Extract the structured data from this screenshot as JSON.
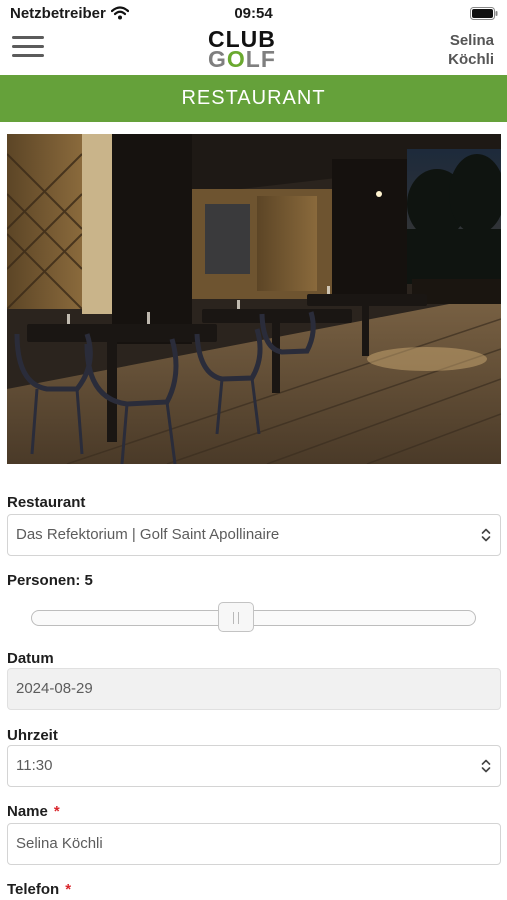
{
  "status_bar": {
    "carrier": "Netzbetreiber",
    "time": "09:54"
  },
  "header": {
    "logo_line1": "CLUB",
    "logo_line2_a": "G",
    "logo_line2_o": "O",
    "logo_line2_b": "LF",
    "user_first": "Selina",
    "user_last": "Köchli"
  },
  "page_title": "RESTAURANT",
  "form": {
    "restaurant_label": "Restaurant",
    "restaurant_value": "Das Refektorium | Golf Saint Apollinaire",
    "persons_label": "Personen: 5",
    "persons_value": 5,
    "persons_fraction": 0.46,
    "date_label": "Datum",
    "date_value": "2024-08-29",
    "time_label": "Uhrzeit",
    "time_value": "11:30",
    "name_label": "Name",
    "name_value": "Selina Köchli",
    "phone_label": "Telefon",
    "required_mark": "*"
  },
  "colors": {
    "accent": "#65a13a",
    "required": "#d9262c",
    "logo_green": "#6aa92f"
  },
  "icons": {
    "menu": "hamburger-menu-icon",
    "wifi": "wifi-icon",
    "battery": "battery-icon",
    "select": "chevron-updown-icon"
  }
}
